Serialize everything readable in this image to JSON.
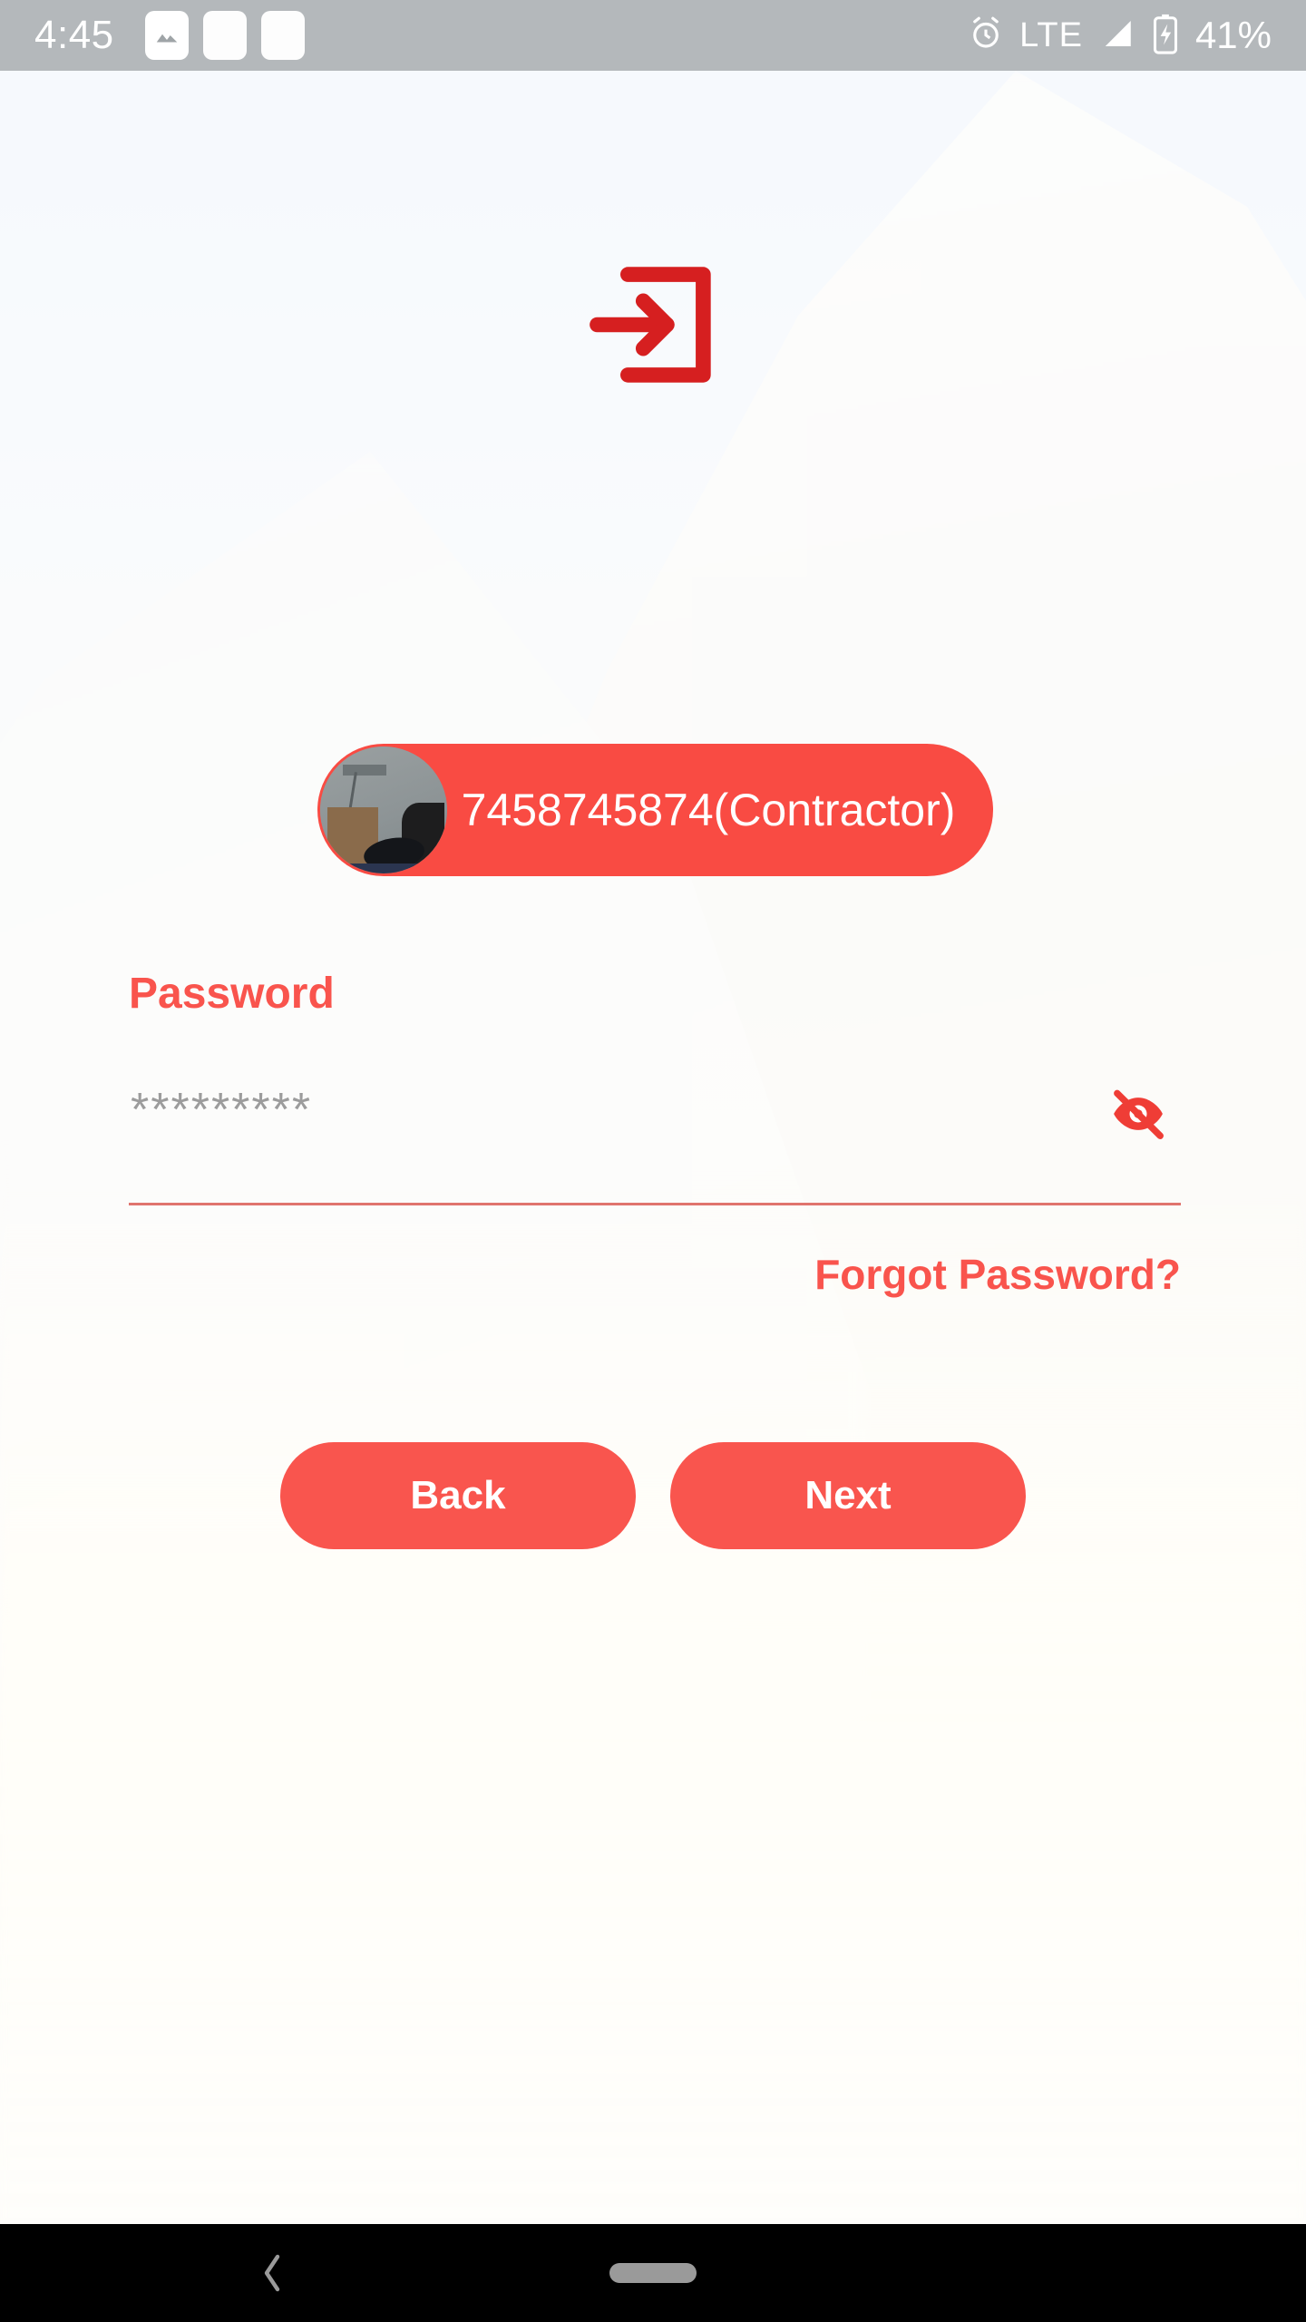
{
  "status_bar": {
    "time": "4:45",
    "notification_icons": [
      "image-icon",
      "blank-notification-icon",
      "blank-notification-icon"
    ],
    "alarm_icon": "alarm-icon",
    "network": "LTE",
    "signal_icon": "signal-bars-icon",
    "battery_icon": "battery-charging-icon",
    "battery_percent": "41%",
    "background_color": "#b4b8bb"
  },
  "screen": {
    "app_icon": "login-arrow-icon",
    "accent_color": "#f9544d",
    "icon_color": "#d61f20"
  },
  "user_chip": {
    "avatar": "user-avatar-photo",
    "label": "7458745874(Contractor)",
    "background_color": "#f94b43",
    "text_color": "#ffffff"
  },
  "password_section": {
    "label": "Password",
    "value": "*********",
    "placeholder": "Password",
    "toggle_icon": "eye-off-icon",
    "toggle_state": "hidden",
    "underline_color": "#e0746e",
    "forgot_label": "Forgot Password?"
  },
  "actions": {
    "back_label": "Back",
    "next_label": "Next"
  },
  "nav_bar": {
    "back_icon": "chevron-left-icon",
    "home_icon": "home-pill-icon"
  }
}
